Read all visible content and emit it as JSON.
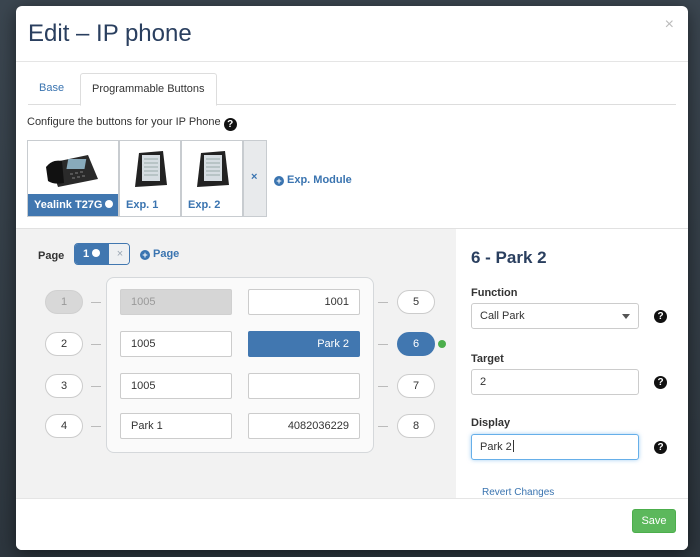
{
  "modal": {
    "title": "Edit – IP phone",
    "close": "×"
  },
  "tabs": [
    {
      "label": "Base"
    },
    {
      "label": "Programmable Buttons"
    }
  ],
  "config": {
    "label": "Configure the buttons for your IP Phone",
    "help": "?"
  },
  "devices": [
    {
      "label": "Yealink T27G",
      "selected": true
    },
    {
      "label": "Exp. 1"
    },
    {
      "label": "Exp. 2"
    }
  ],
  "remove_device": "×",
  "add_exp_module": "Exp. Module",
  "add_plus": "+",
  "page_selector": {
    "label": "Page",
    "current": "1",
    "remove": "×",
    "add": "Page"
  },
  "keys": {
    "left": [
      {
        "num": "1",
        "value": "1005",
        "state": "disabled"
      },
      {
        "num": "2",
        "value": "1005",
        "state": "normal"
      },
      {
        "num": "3",
        "value": "1005",
        "state": "normal"
      },
      {
        "num": "4",
        "value": "Park 1",
        "state": "normal"
      }
    ],
    "right": [
      {
        "num": "5",
        "value": "1001",
        "state": "normal"
      },
      {
        "num": "6",
        "value": "Park 2",
        "state": "selected"
      },
      {
        "num": "7",
        "value": "",
        "state": "normal"
      },
      {
        "num": "8",
        "value": "4082036229",
        "state": "normal"
      }
    ]
  },
  "panel": {
    "title": "6 - Park 2",
    "function_label": "Function",
    "function_value": "Call Park",
    "target_label": "Target",
    "target_value": "2",
    "display_label": "Display",
    "display_value": "Park 2",
    "revert": "Revert Changes"
  },
  "footer": {
    "save": "Save"
  },
  "colors": {
    "primary": "#4177b0",
    "link": "#3a74b0",
    "save": "#5cb85c",
    "status_green": "#4cae4c"
  }
}
